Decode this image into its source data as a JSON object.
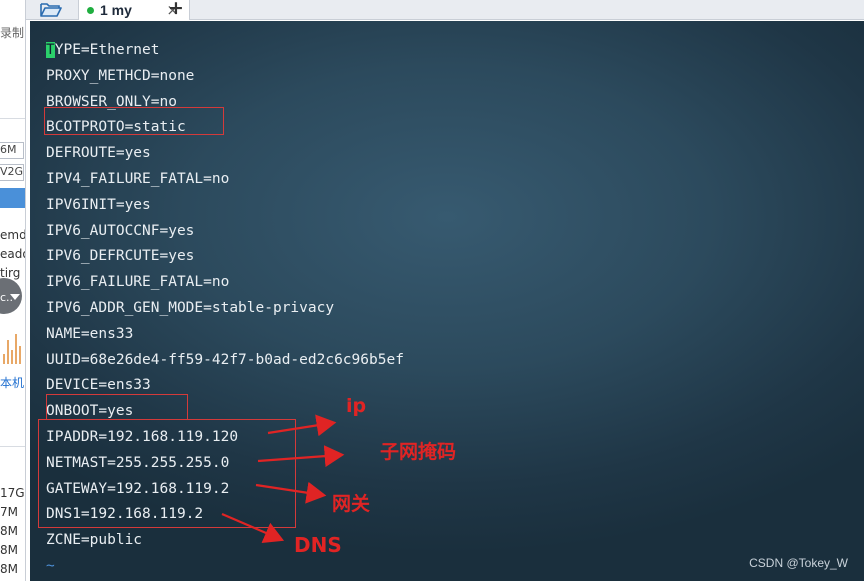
{
  "left_strip": {
    "items": [
      "录制",
      "6M",
      "V2G",
      "emd",
      "eado",
      "tirg",
      "c..",
      "本机",
      "17G",
      "7M",
      "8M",
      "8M",
      "8M"
    ]
  },
  "tabbar": {
    "folder_icon": "folder-open-icon",
    "tab_label": "1 my",
    "tab_status_color": "#1fae3f",
    "close_glyph": "×",
    "add_glyph": "+"
  },
  "terminal": {
    "lines": [
      "TYPE=Ethernet",
      "PROXY_METHCD=none",
      "BROWSER_ONLY=no",
      "BCOTPROTO=static",
      "DEFROUTE=yes",
      "IPV4_FAILURE_FATAL=no",
      "IPV6INIT=yes",
      "IPV6_AUTOCCNF=yes",
      "IPV6_DEFRCUTE=yes",
      "IPV6_FAILURE_FATAL=no",
      "IPV6_ADDR_GEN_MODE=stable-privacy",
      "NAME=ens33",
      "UUID=68e26de4-ff59-42f7-b0ad-ed2c6c96b5ef",
      "DEVICE=ens33",
      "ONBOOT=yes",
      "IPADDR=192.168.119.120",
      "NETMAST=255.255.255.0",
      "GATEWAY=192.168.119.2",
      "DNS1=192.168.119.2",
      "ZCNE=public"
    ],
    "tilde": "~",
    "cursor_color": "#2bd06b"
  },
  "annotations": {
    "ip": "ip",
    "mask": "子网掩码",
    "gateway": "网关",
    "dns": "DNS",
    "color": "#e02424"
  },
  "watermark": "CSDN @Tokey_W"
}
